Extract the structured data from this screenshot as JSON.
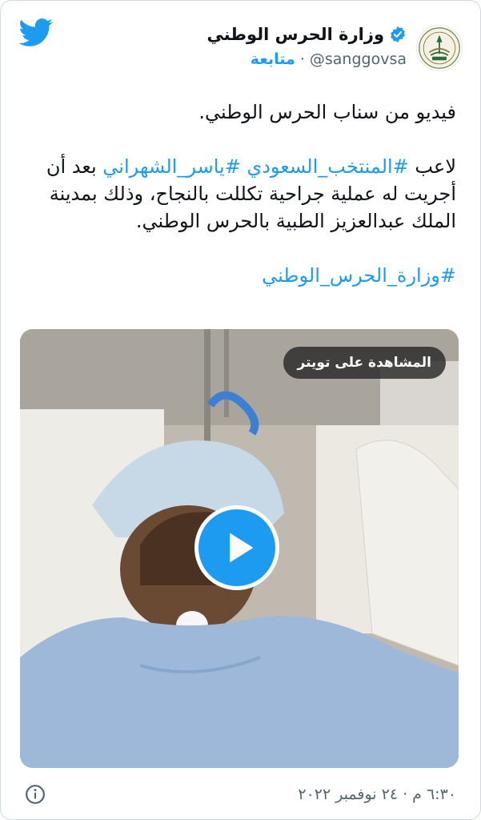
{
  "header": {
    "display_name": "وزارة الحرس الوطني",
    "handle": "@sanggovsa",
    "separator": "·",
    "follow_label": "متابعة"
  },
  "icons": {
    "brand": "twitter-bird-icon",
    "verified": "verified-badge-icon",
    "avatar": "national-guard-emblem",
    "play": "play-icon",
    "info": "info-icon"
  },
  "tweet": {
    "line1": "فيديو من سناب الحرس الوطني.",
    "p2_prefix": "لاعب ",
    "p2_tag1": "#المنتخب_السعودي",
    "p2_space": " ",
    "p2_tag2": "#ياسر_الشهراني",
    "p2_suffix": " بعد أن أجريت له عملية جراحية تكللت بالنجاح، وذلك بمدينة الملك عبدالعزيز الطبية بالحرس الوطني.",
    "p3_tag": "#وزارة_الحرس_الوطني"
  },
  "video": {
    "watch_label": "المشاهدة على تويتر"
  },
  "footer": {
    "timestamp": "٦:٣٠ م · ٢٤ نوفمبر ٢٠٢٢"
  },
  "colors": {
    "brand_blue": "#1d9bf0",
    "text": "#0f1419",
    "muted": "#536471"
  }
}
